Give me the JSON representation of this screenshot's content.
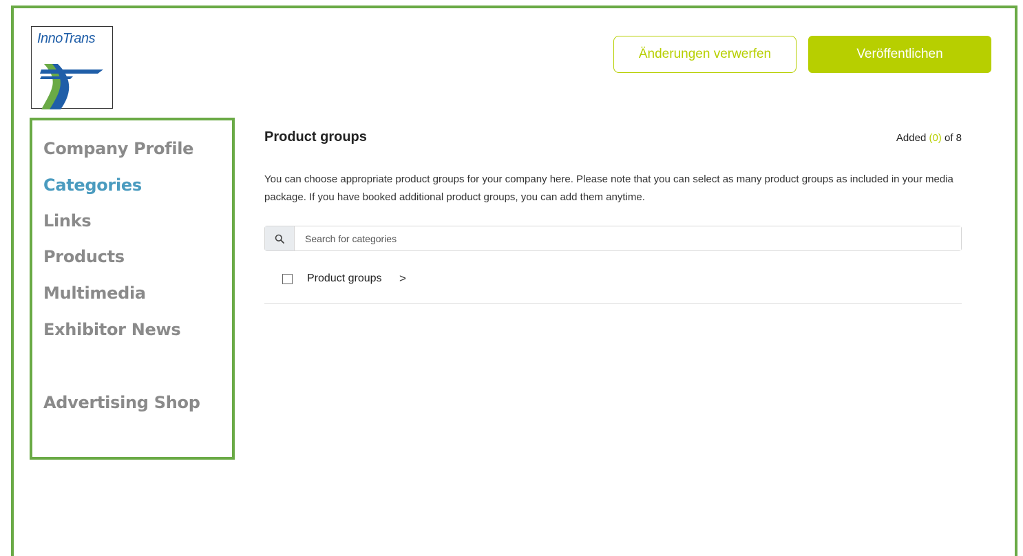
{
  "logo": {
    "text": "InnoTrans"
  },
  "header": {
    "discard_label": "Änderungen verwerfen",
    "publish_label": "Veröffentlichen"
  },
  "sidebar": {
    "items": [
      {
        "label": "Company Profile",
        "active": false
      },
      {
        "label": "Categories",
        "active": true
      },
      {
        "label": "Links",
        "active": false
      },
      {
        "label": "Products",
        "active": false
      },
      {
        "label": "Multimedia",
        "active": false
      },
      {
        "label": "Exhibitor News",
        "active": false
      },
      {
        "label": "Advertising Shop",
        "active": false
      }
    ]
  },
  "main": {
    "title": "Product groups",
    "counter": {
      "prefix": "Added ",
      "count": "(0)",
      "suffix": " of 8"
    },
    "description": "You can choose appropriate product groups for your company here. Please note that you can select as many product groups as included in your media package. If you have booked additional product groups, you can add them anytime.",
    "search": {
      "placeholder": "Search for categories",
      "value": ""
    },
    "groups": [
      {
        "label": "Product groups",
        "checked": false
      }
    ]
  },
  "colors": {
    "accent": "#b7cf00",
    "frame": "#6aaa46",
    "active_nav": "#4a9bbf",
    "nav": "#8a8a8a"
  },
  "icons": [
    "search-icon",
    "chevron-right-icon",
    "innotrans-logo"
  ]
}
